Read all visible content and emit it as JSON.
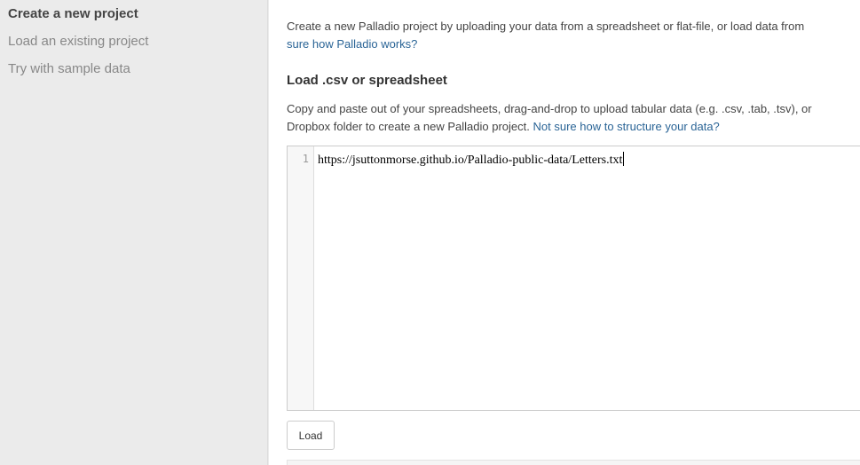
{
  "sidebar": {
    "items": [
      {
        "label": "Create a new project"
      },
      {
        "label": "Load an existing project"
      },
      {
        "label": "Try with sample data"
      }
    ]
  },
  "intro": {
    "text": "Create a new Palladio project by uploading your data from a spreadsheet or flat-file, or load data from",
    "link": "sure how Palladio works?"
  },
  "section": {
    "title": "Load .csv or spreadsheet",
    "desc_line1": "Copy and paste out of your spreadsheets, drag-and-drop to upload tabular data (e.g. .csv, .tab, .tsv), or",
    "desc_line2": "Dropbox folder to create a new Palladio project.",
    "desc_link": "Not sure how to structure your data?"
  },
  "editor": {
    "line_number": "1",
    "content": "https://jsuttonmorse.github.io/Palladio-public-data/Letters.txt"
  },
  "buttons": {
    "load": "Load"
  }
}
